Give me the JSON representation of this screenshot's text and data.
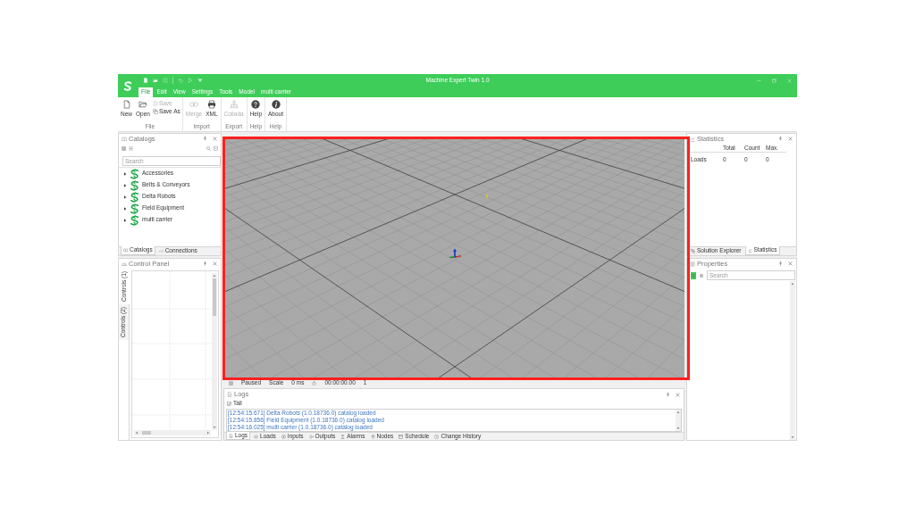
{
  "window": {
    "title": "Machine Expert Twin 1.0"
  },
  "ribbon_tabs": [
    {
      "label": "File",
      "selected": true
    },
    {
      "label": "Edit",
      "selected": false
    },
    {
      "label": "View",
      "selected": false
    },
    {
      "label": "Settings",
      "selected": false
    },
    {
      "label": "Tools",
      "selected": false
    },
    {
      "label": "Model",
      "selected": false
    },
    {
      "label": "multi carrier",
      "selected": false
    }
  ],
  "ribbon_groups": [
    {
      "label": "File",
      "buttons": [
        {
          "label": "New",
          "disabled": false
        },
        {
          "label": "Open",
          "disabled": false
        }
      ],
      "small_buttons": [
        {
          "label": "Save",
          "disabled": true
        },
        {
          "label": "Save As",
          "disabled": false
        }
      ]
    },
    {
      "label": "Import",
      "buttons": [
        {
          "label": "Merge",
          "disabled": true
        },
        {
          "label": "XML",
          "disabled": false
        }
      ]
    },
    {
      "label": "Export",
      "buttons": [
        {
          "label": "Collada",
          "disabled": true
        }
      ]
    },
    {
      "label": "Help",
      "buttons": [
        {
          "label": "Help",
          "disabled": false
        }
      ]
    },
    {
      "label": "Help",
      "buttons": [
        {
          "label": "About",
          "disabled": false
        }
      ]
    }
  ],
  "catalogs": {
    "title": "Catalogs",
    "search": {
      "placeholder": "Search"
    },
    "items": [
      {
        "label": "Accessories",
        "expanded": false
      },
      {
        "label": "Belts & Conveyors",
        "expanded": false
      },
      {
        "label": "Delta Robots",
        "expanded": false
      },
      {
        "label": "Field Equipment",
        "expanded": false
      },
      {
        "label": "multi carrier",
        "expanded": false
      }
    ],
    "tabs": [
      {
        "label": "Catalogs",
        "selected": true
      },
      {
        "label": "Connections",
        "selected": false
      }
    ]
  },
  "control_panel": {
    "title": "Control Panel",
    "tabs": [
      {
        "label": "Controls (1)",
        "selected": true
      },
      {
        "label": "Controls (2)",
        "selected": false
      }
    ]
  },
  "status_bar": {
    "items": [
      "Paused",
      "Scale",
      "0 ms",
      "00:00:00.00",
      "1"
    ]
  },
  "logs": {
    "title": "Logs",
    "tail": {
      "label": "Tail",
      "checked": true
    },
    "lines": [
      "[12:54:15.671] Delta Robots (1.0.18736.0) catalog loaded",
      "[12:54:15.856] Field Equipment (1.0.18736.0) catalog loaded",
      "[12:54:16.025] multi carrier (1.0.18736.0) catalog loaded"
    ],
    "tabs": [
      {
        "label": "Logs",
        "selected": true
      },
      {
        "label": "Loads",
        "selected": false
      },
      {
        "label": "Inputs",
        "selected": false
      },
      {
        "label": "Outputs",
        "selected": false
      },
      {
        "label": "Alarms",
        "selected": false
      },
      {
        "label": "Nodes",
        "selected": false
      },
      {
        "label": "Schedule",
        "selected": false
      },
      {
        "label": "Change History",
        "selected": false
      }
    ]
  },
  "statistics": {
    "title": "Statistics",
    "columns": [
      "Total",
      "Count",
      "Max."
    ],
    "rows": [
      {
        "label": "Loads",
        "values": [
          "0",
          "0",
          "0"
        ]
      }
    ],
    "tabs": [
      {
        "label": "Solution Explorer",
        "selected": false
      },
      {
        "label": "Statistics",
        "selected": true
      }
    ]
  },
  "properties": {
    "title": "Properties",
    "view_buttons": [
      {
        "selected": true
      },
      {
        "selected": false
      }
    ],
    "search": {
      "placeholder": "Search"
    }
  }
}
